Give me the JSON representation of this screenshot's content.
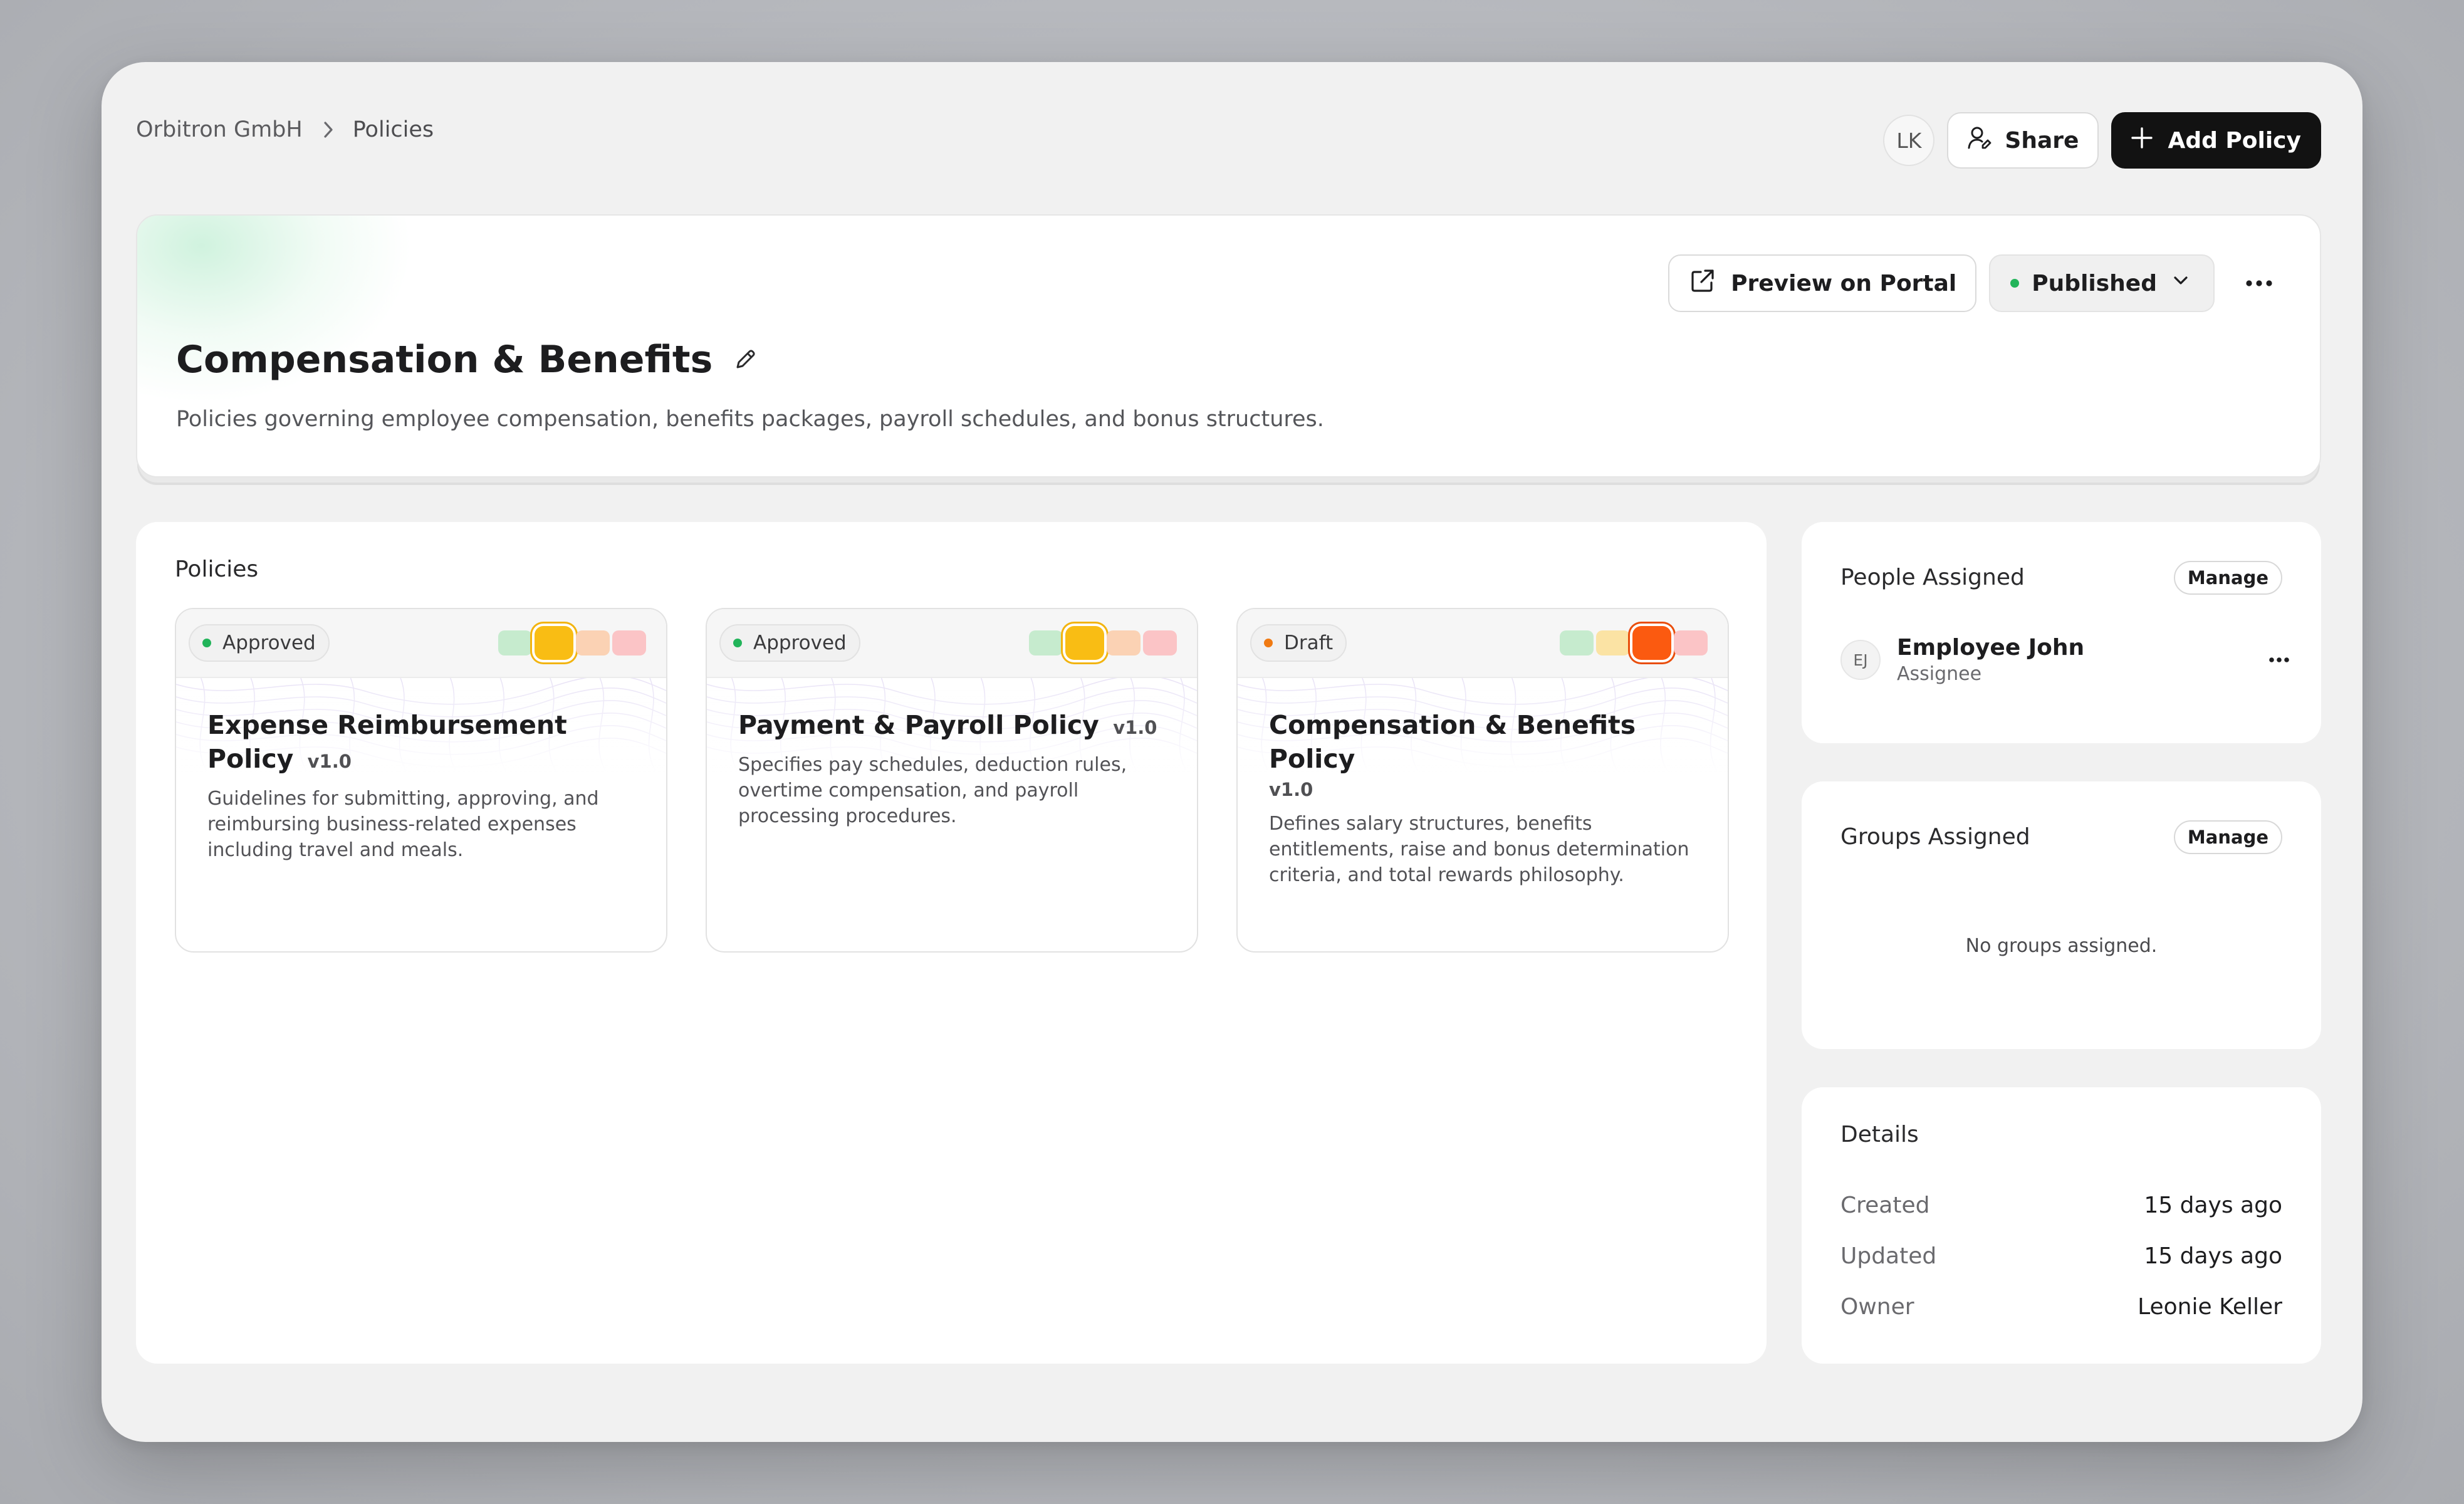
{
  "breadcrumb": {
    "org": "Orbitron GmbH",
    "current": "Policies"
  },
  "top_actions": {
    "avatar_initials": "LK",
    "share_label": "Share",
    "add_label": "Add Policy"
  },
  "header": {
    "title": "Compensation & Benefits",
    "description": "Policies governing employee compensation, benefits packages, payroll schedules, and bonus structures.",
    "preview_label": "Preview on Portal",
    "status_label": "Published",
    "status_color": "#22b45a"
  },
  "policies": {
    "section_title": "Policies",
    "cards": [
      {
        "status": "Approved",
        "status_color": "#22b45a",
        "title": "Expense Reimbursement Policy",
        "version": "v1.0",
        "description": "Guidelines for submitting, approving, and reimbursing business-related expenses including travel and meals.",
        "risk_level": 2,
        "risk_colors": [
          "#c6ebce",
          "#f9bd14",
          "#fbd2b4",
          "#fbc4c6"
        ]
      },
      {
        "status": "Approved",
        "status_color": "#22b45a",
        "title": "Payment & Payroll Policy",
        "version": "v1.0",
        "description": "Specifies pay schedules, deduction rules, overtime compensation, and payroll processing procedures.",
        "risk_level": 2,
        "risk_colors": [
          "#c6ebce",
          "#f9bd14",
          "#fbd2b4",
          "#fbc4c6"
        ]
      },
      {
        "status": "Draft",
        "status_color": "#f07a12",
        "title": "Compensation & Benefits Policy",
        "version": "v1.0",
        "description": "Defines salary structures, benefits entitlements, raise and bonus determination criteria, and total rewards philosophy.",
        "risk_level": 3,
        "risk_colors": [
          "#c6ebce",
          "#fbe3a4",
          "#fb5a10",
          "#fbc4c6"
        ]
      }
    ]
  },
  "people": {
    "title": "People Assigned",
    "manage_label": "Manage",
    "items": [
      {
        "initials": "EJ",
        "name": "Employee John",
        "role": "Assignee"
      }
    ]
  },
  "groups": {
    "title": "Groups Assigned",
    "manage_label": "Manage",
    "empty_text": "No groups assigned."
  },
  "details": {
    "title": "Details",
    "rows": [
      {
        "key": "Created",
        "value": "15 days ago"
      },
      {
        "key": "Updated",
        "value": "15 days ago"
      },
      {
        "key": "Owner",
        "value": "Leonie Keller"
      }
    ]
  }
}
